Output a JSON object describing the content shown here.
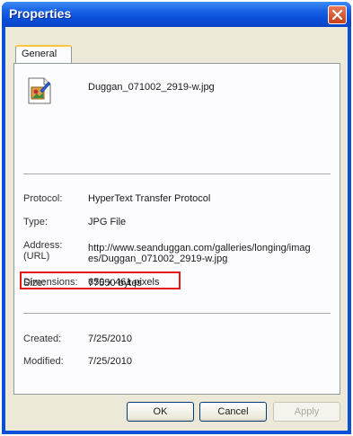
{
  "window": {
    "title": "Properties",
    "close_icon": "close-icon"
  },
  "tabs": [
    {
      "label": "General"
    }
  ],
  "file": {
    "icon": "jpg-file-icon",
    "name": "Duggan_071002_2919-w.jpg"
  },
  "properties": {
    "protocol": {
      "label": "Protocol:",
      "value": "HyperText Transfer Protocol"
    },
    "type": {
      "label": "Type:",
      "value": "JPG File"
    },
    "address": {
      "label_line1": "Address:",
      "label_line2": "(URL)",
      "value_line1": "http://www.seanduggan.com/galleries/longing/imag",
      "value_line2": "es/Duggan_071002_2919-w.jpg"
    },
    "size": {
      "label": "Size:",
      "value": "77550 bytes"
    },
    "dimensions": {
      "label": "Dimensions:",
      "value": "650 x 461 pixels"
    },
    "created": {
      "label": "Created:",
      "value": "7/25/2010"
    },
    "modified": {
      "label": "Modified:",
      "value": "7/25/2010"
    }
  },
  "buttons": {
    "ok": "OK",
    "cancel": "Cancel",
    "apply": "Apply"
  },
  "colors": {
    "titlebar": "#0a4ed8",
    "highlight": "#e11a1a",
    "face": "#ece9d8"
  }
}
